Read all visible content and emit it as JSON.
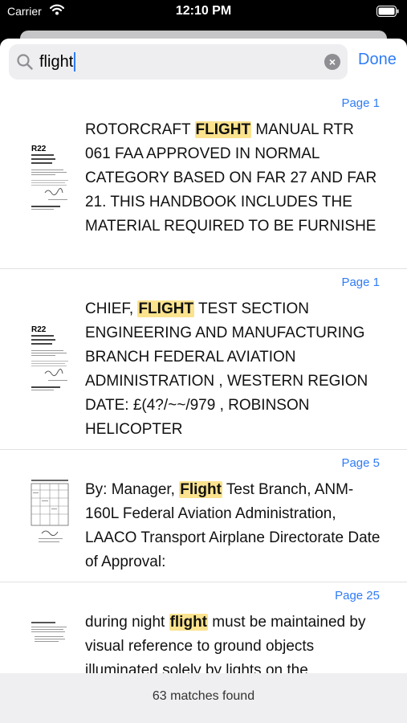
{
  "status_bar": {
    "carrier": "Carrier",
    "time": "12:10 PM"
  },
  "search": {
    "query": "flight",
    "done_label": "Done"
  },
  "results": [
    {
      "page": "Page 1",
      "before": "ROTORCRAFT ",
      "match": "FLIGHT",
      "after": " MANUAL RTR 061 FAA APPROVED IN NORMAL CATEGORY BASED ON FAR 27 AND FAR 21. THIS HANDBOOK INCLUDES THE MATERIAL REQUIRED TO BE FURNISHE",
      "thumb_title": "R22",
      "thumb_subtitle": "PILOT'S OPERATING HANDBOOK"
    },
    {
      "page": "Page 1",
      "before": "CHIEF, ",
      "match": "FLIGHT",
      "after": " TEST SECTION ENGINEERING AND MANUFACTURING BRANCH FEDERAL AVIATION ADMINISTRATION , WESTERN REGION DATE: £(4?/~~/979 , ROBINSON HELICOPTER",
      "thumb_title": "R22",
      "thumb_subtitle": "PILOT'S OPERATING HANDBOOK"
    },
    {
      "page": "Page 5",
      "before": "By: Manager, ",
      "match": "Flight",
      "after": " Test Branch, ANM-160L Federal Aviation Administration, LAACO Transport Airplane Directorate Date of Approval:"
    },
    {
      "page": "Page 25",
      "before": "during night ",
      "match": "flight",
      "after": " must be maintained by visual reference to ground objects illuminated solely by lights on the"
    }
  ],
  "footer": {
    "matches": "63 matches found"
  },
  "colors": {
    "accent": "#2F7CF6",
    "highlight": "#FBE38E"
  }
}
